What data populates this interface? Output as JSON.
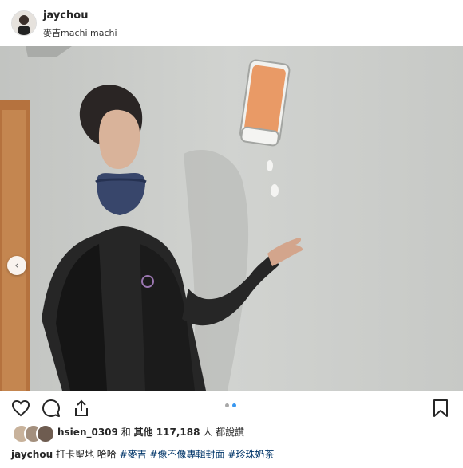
{
  "post": {
    "username": "jaychou",
    "location": "麥吉machi machi"
  },
  "likes": {
    "liker": "hsien_0309",
    "joiner": "和",
    "others_prefix": "其他",
    "count": "117,188",
    "suffix": "人 都說讚"
  },
  "caption": {
    "username": "jaychou",
    "text": "打卡聖地 哈哈",
    "tags": [
      "#麥吉",
      "#像不像專輯封面",
      "#珍珠奶茶"
    ]
  },
  "carousel": {
    "total": 2,
    "active": 2
  },
  "icons": [
    "heart-icon",
    "comment-icon",
    "share-icon",
    "bookmark-icon",
    "chevron-left-icon"
  ],
  "colors": {
    "tag": "#003569",
    "dot_active": "#3897f0",
    "dot_inactive": "#a8a8a8"
  }
}
